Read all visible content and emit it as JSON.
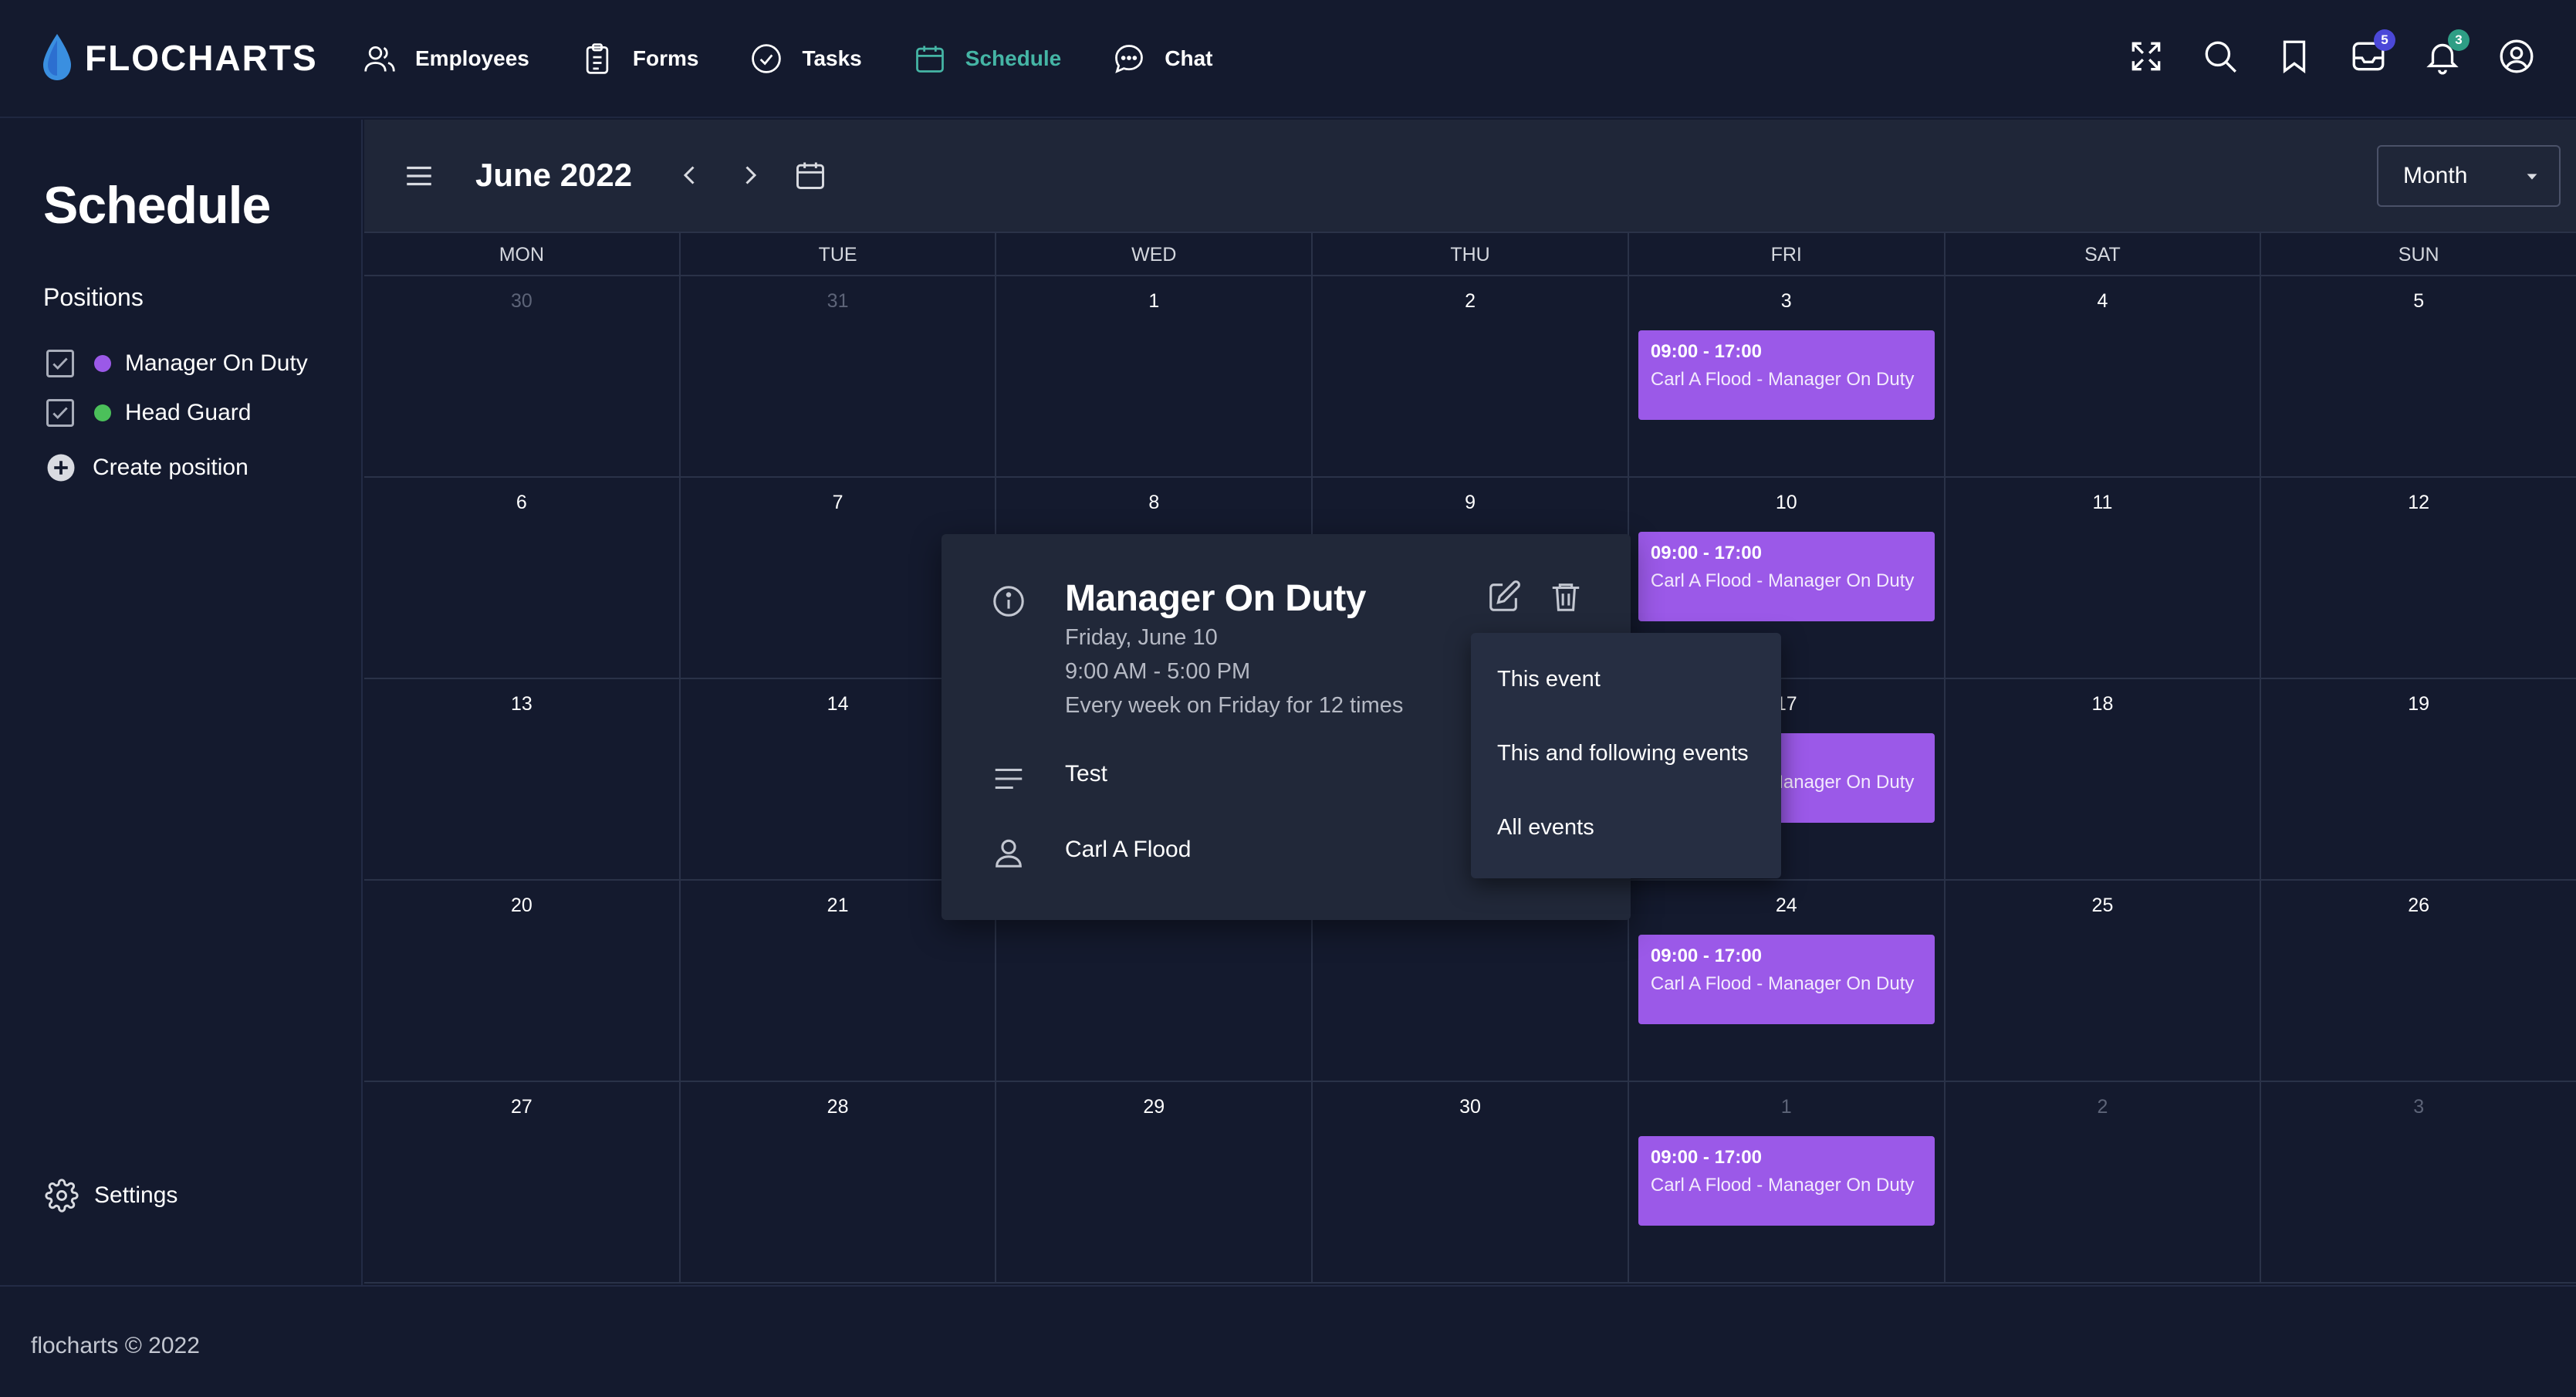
{
  "app": {
    "name": "FLOCHARTS"
  },
  "nav": {
    "items": [
      {
        "label": "Employees",
        "icon": "users-icon"
      },
      {
        "label": "Forms",
        "icon": "clipboard-icon"
      },
      {
        "label": "Tasks",
        "icon": "check-circle-icon"
      },
      {
        "label": "Schedule",
        "icon": "calendar-icon",
        "active": true
      },
      {
        "label": "Chat",
        "icon": "chat-icon"
      }
    ]
  },
  "top_icons": {
    "inbox_badge": "5",
    "notifications_badge": "3",
    "inbox_badge_color": "#4b48d8",
    "notifications_badge_color": "#2e9e85"
  },
  "sidebar": {
    "title": "Schedule",
    "positions_label": "Positions",
    "positions": [
      {
        "label": "Manager On Duty",
        "color": "#9b59e8",
        "checked": true
      },
      {
        "label": "Head Guard",
        "color": "#4bc05a",
        "checked": true
      }
    ],
    "create_label": "Create position",
    "settings_label": "Settings"
  },
  "calendar": {
    "month_label": "June 2022",
    "view": "Month",
    "weekdays": [
      "MON",
      "TUE",
      "WED",
      "THU",
      "FRI",
      "SAT",
      "SUN"
    ],
    "weeks": [
      [
        "30",
        "31",
        "1",
        "2",
        "3",
        "4",
        "5"
      ],
      [
        "6",
        "7",
        "8",
        "9",
        "10",
        "11",
        "12"
      ],
      [
        "13",
        "14",
        "15",
        "16",
        "17",
        "18",
        "19"
      ],
      [
        "20",
        "21",
        "22",
        "23",
        "24",
        "25",
        "26"
      ],
      [
        "27",
        "28",
        "29",
        "30",
        "1",
        "2",
        "3"
      ]
    ],
    "muted_days": {
      "0": [
        0,
        1
      ],
      "4": [
        4,
        5,
        6
      ]
    },
    "event": {
      "time": "09:00 - 17:00",
      "title": "Carl A Flood - Manager On Duty",
      "partial_title": "Manager On",
      "color": "#9b59e8"
    }
  },
  "popup": {
    "title": "Manager On Duty",
    "date": "Friday, June 10",
    "time": "9:00 AM - 5:00 PM",
    "recurrence": "Every week on Friday for 12 times",
    "description": "Test",
    "person": "Carl A Flood"
  },
  "delete_menu": {
    "items": [
      "This event",
      "This and following events",
      "All events"
    ]
  },
  "footer": {
    "text": "flocharts © 2022"
  }
}
